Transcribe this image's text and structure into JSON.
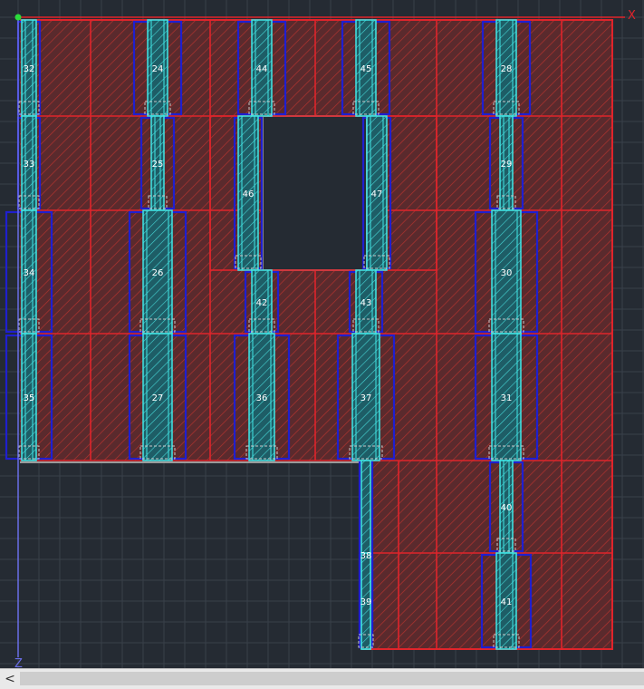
{
  "axes": {
    "x_label": "X",
    "z_label": "Z",
    "x_color": "#e0242b",
    "z_color": "#6a6ee8"
  },
  "colors": {
    "background": "#252b33",
    "grid": "#39404a",
    "panel_fill": "#5a2a2d",
    "panel_hatch": "#b0332f",
    "panel_edge": "#e0242b",
    "column_outer": "#1f1fcf",
    "column_inner": "#40e6e6",
    "opening_edge": "#8a8a8a"
  },
  "columns": {
    "labels": [
      "32",
      "24",
      "44",
      "45",
      "28",
      "33",
      "25",
      "46",
      "47",
      "29",
      "34",
      "26",
      "30",
      "42",
      "43",
      "35",
      "27",
      "36",
      "37",
      "31",
      "38",
      "40",
      "39",
      "41"
    ]
  },
  "scrollbar": {
    "left_arrow": "<"
  }
}
